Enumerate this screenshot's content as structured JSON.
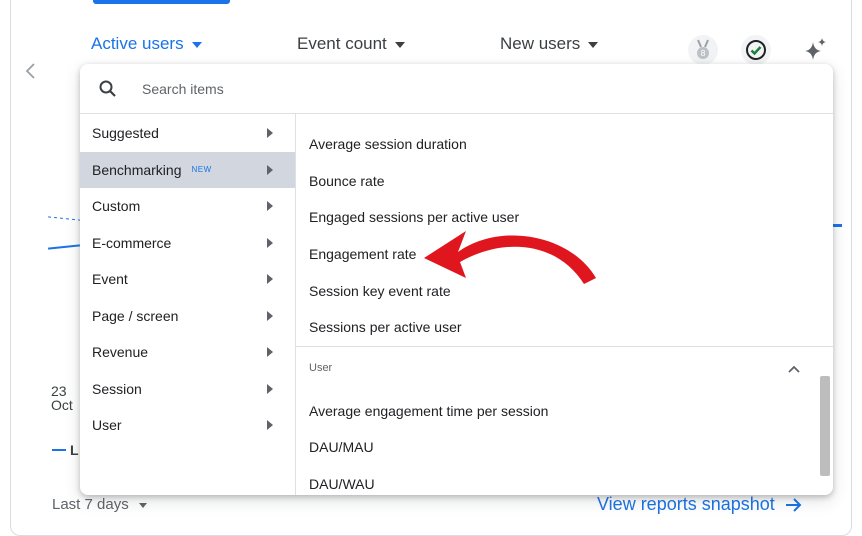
{
  "metric_tabs": [
    {
      "label": "Active users",
      "active": true
    },
    {
      "label": "Event count",
      "active": false
    },
    {
      "label": "New users",
      "active": false
    }
  ],
  "background": {
    "date_day": "23",
    "date_month": "Oct",
    "legend_label": "L"
  },
  "footer": {
    "date_range": "Last 7 days",
    "snapshot_link": "View reports snapshot"
  },
  "dropdown": {
    "search_placeholder": "Search items",
    "categories": [
      {
        "label": "Suggested"
      },
      {
        "label": "Benchmarking",
        "tag": "NEW",
        "selected": true
      },
      {
        "label": "Custom"
      },
      {
        "label": "E-commerce"
      },
      {
        "label": "Event"
      },
      {
        "label": "Page / screen"
      },
      {
        "label": "Revenue"
      },
      {
        "label": "Session"
      },
      {
        "label": "User"
      }
    ],
    "session_items": [
      "Average session duration",
      "Bounce rate",
      "Engaged sessions per active user",
      "Engagement rate",
      "Session key event rate",
      "Sessions per active user"
    ],
    "user_section_label": "User",
    "user_items": [
      "Average engagement time per session",
      "DAU/MAU",
      "DAU/WAU"
    ]
  },
  "colors": {
    "accent": "#1a73e8",
    "selected_bg": "#d2d6de",
    "annotation_arrow": "#e0161f"
  },
  "icons": [
    "chevron-left-icon",
    "search-icon",
    "medal-badge-icon",
    "check-circle-icon",
    "sparkle-icon",
    "chevron-up-icon",
    "arrow-right-icon"
  ]
}
